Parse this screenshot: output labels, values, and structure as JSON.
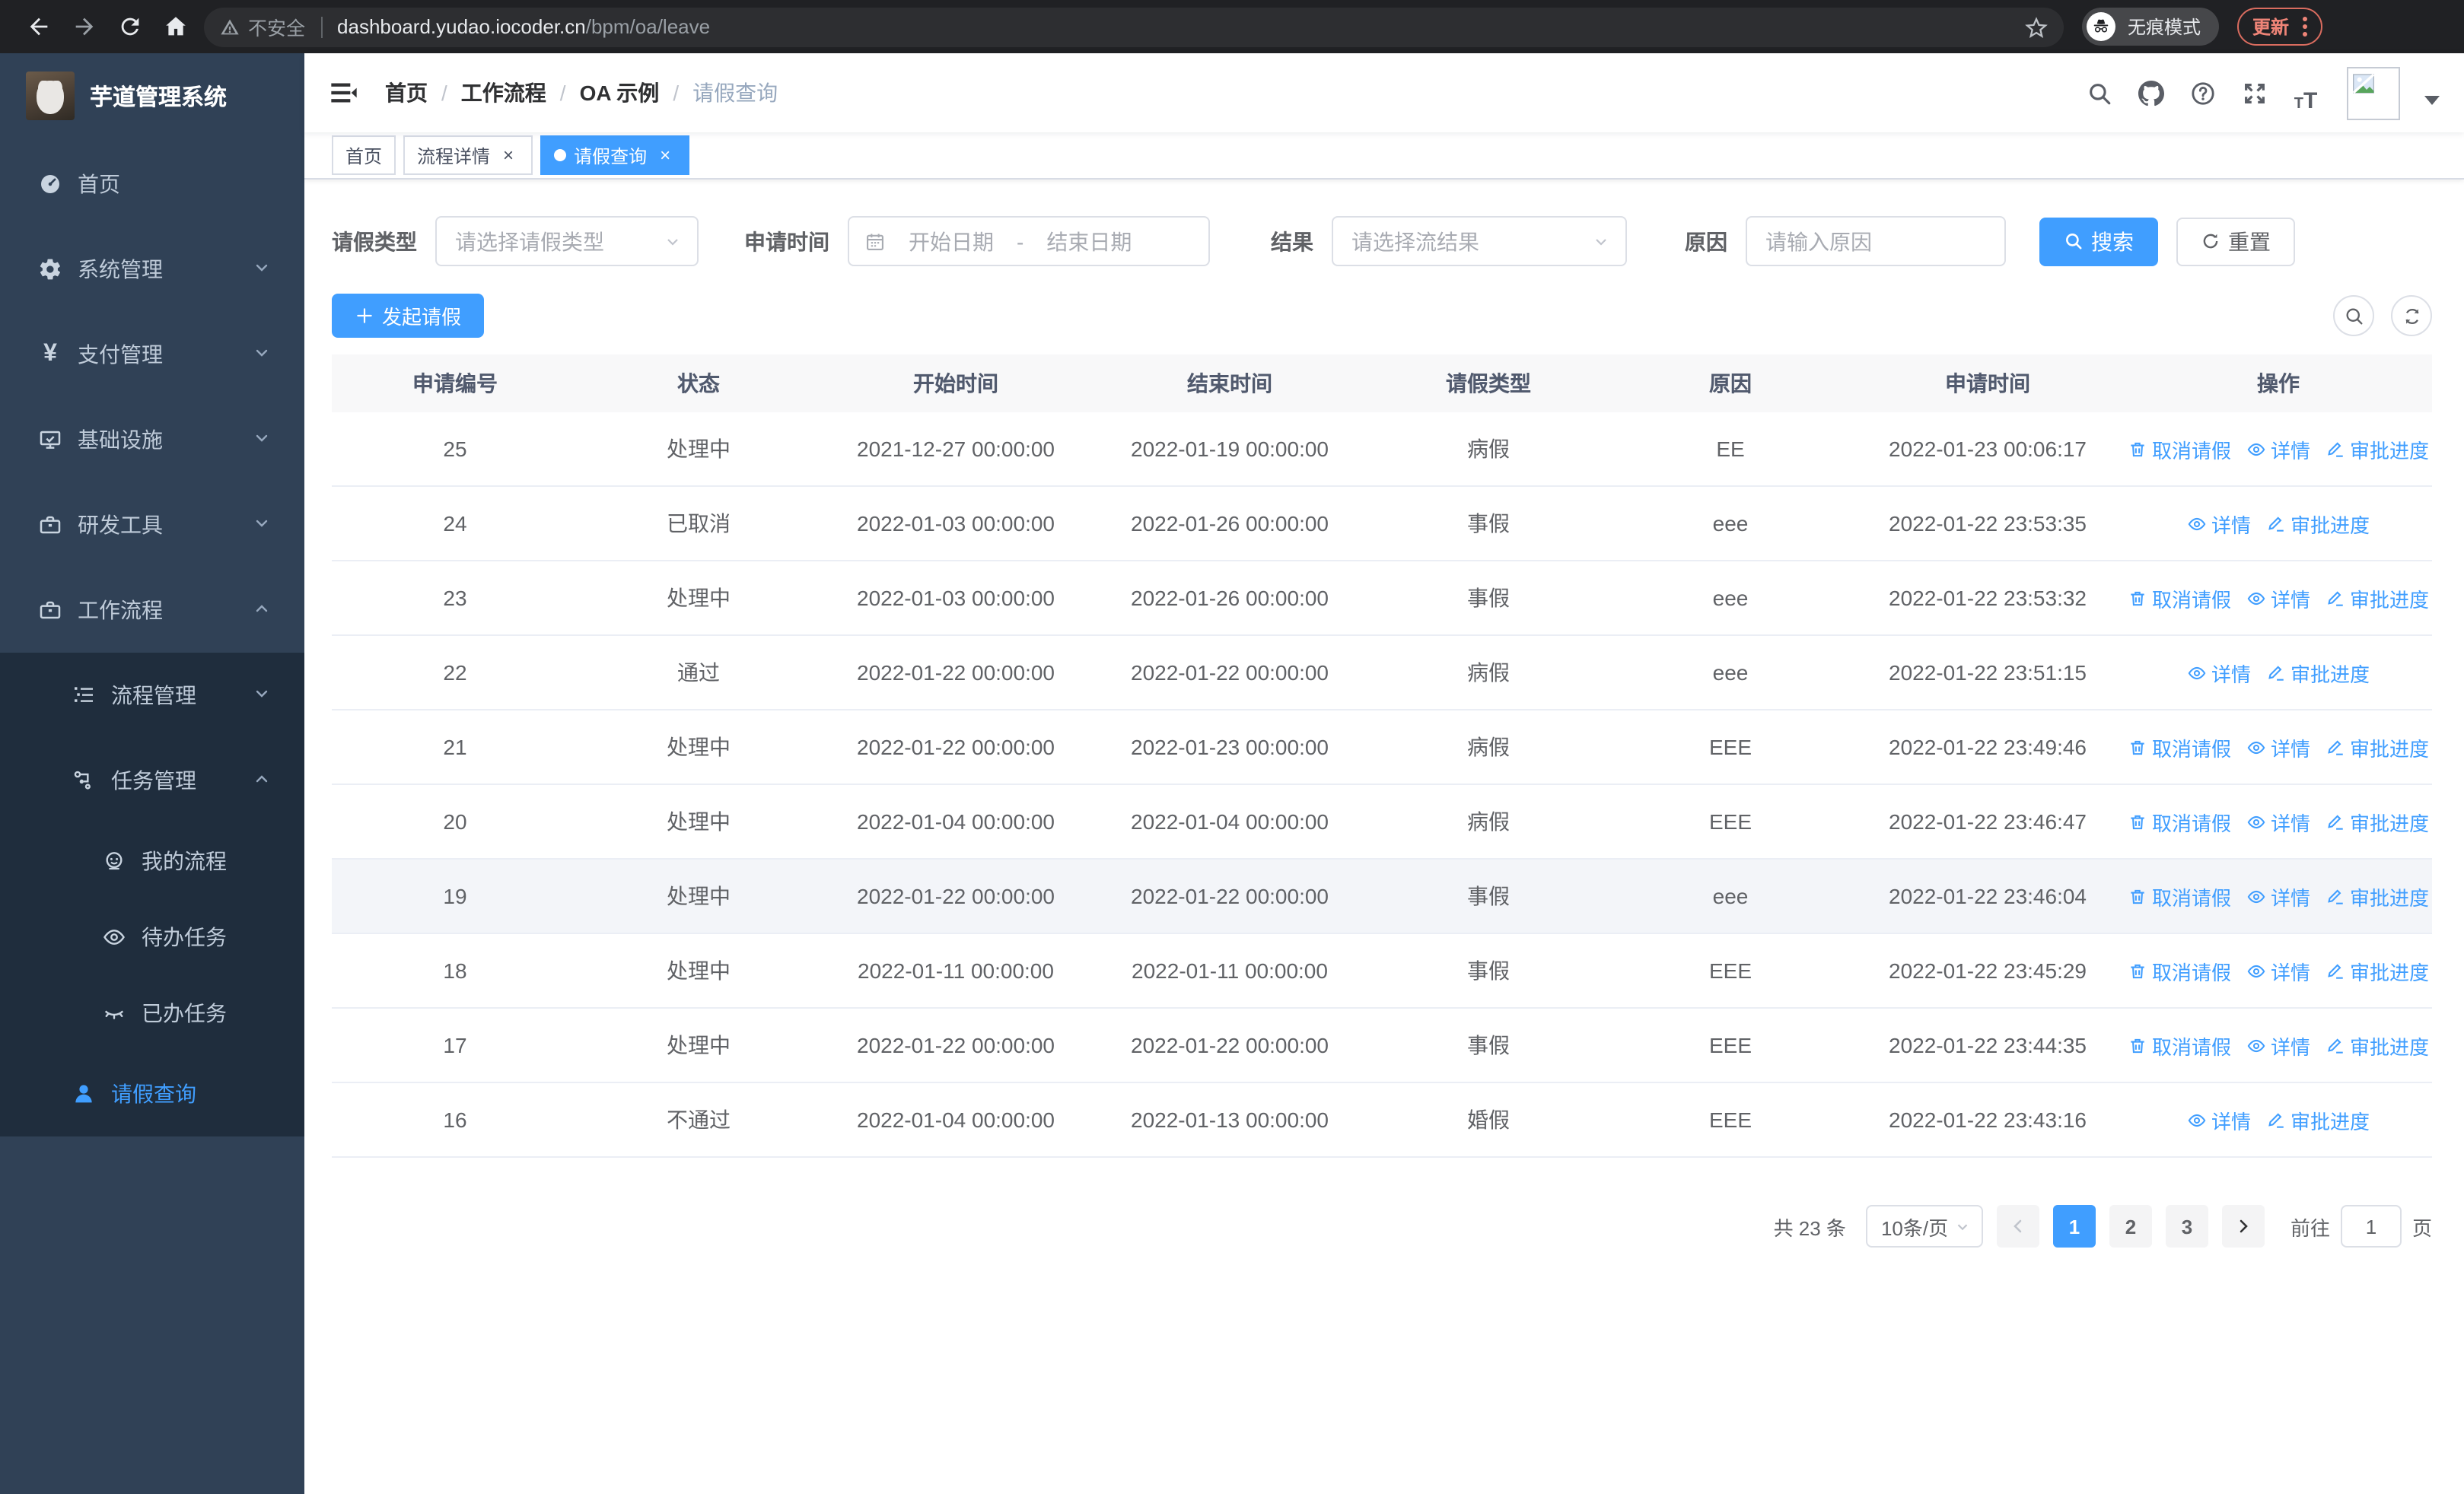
{
  "browser": {
    "security_label": "不安全",
    "url_host": "dashboard.yudao.iocoder.cn",
    "url_path": "/bpm/oa/leave",
    "incognito_label": "无痕模式",
    "update_label": "更新"
  },
  "sidebar": {
    "app_title": "芋道管理系统",
    "items": [
      {
        "label": "首页"
      },
      {
        "label": "系统管理"
      },
      {
        "label": "支付管理"
      },
      {
        "label": "基础设施"
      },
      {
        "label": "研发工具"
      },
      {
        "label": "工作流程"
      },
      {
        "label": "流程管理"
      },
      {
        "label": "任务管理"
      },
      {
        "label": "我的流程"
      },
      {
        "label": "待办任务"
      },
      {
        "label": "已办任务"
      },
      {
        "label": "请假查询"
      }
    ],
    "yen_glyph": "¥"
  },
  "header": {
    "breadcrumbs": [
      "首页",
      "工作流程",
      "OA 示例",
      "请假查询"
    ],
    "breadcrumb_separator": "/"
  },
  "tabs": {
    "close_glyph": "×",
    "items": [
      {
        "label": "首页"
      },
      {
        "label": "流程详情"
      },
      {
        "label": "请假查询"
      }
    ]
  },
  "filters": {
    "leave_type_label": "请假类型",
    "leave_type_placeholder": "请选择请假类型",
    "apply_time_label": "申请时间",
    "start_date_placeholder": "开始日期",
    "range_separator": "-",
    "end_date_placeholder": "结束日期",
    "result_label": "结果",
    "result_placeholder": "请选择流结果",
    "reason_label": "原因",
    "reason_placeholder": "请输入原因",
    "search_label": "搜索",
    "reset_label": "重置"
  },
  "toolbar": {
    "create_label": "发起请假"
  },
  "table": {
    "columns": [
      "申请编号",
      "状态",
      "开始时间",
      "结束时间",
      "请假类型",
      "原因",
      "申请时间",
      "操作"
    ],
    "action_labels": {
      "cancel": "取消请假",
      "detail": "详情",
      "progress": "审批进度"
    },
    "rows": [
      {
        "id": "25",
        "status": "处理中",
        "start": "2021-12-27 00:00:00",
        "end": "2022-01-19 00:00:00",
        "type": "病假",
        "reason": "EE",
        "apply_time": "2022-01-23 00:06:17",
        "actions": [
          "cancel",
          "detail",
          "progress"
        ],
        "highlight": false
      },
      {
        "id": "24",
        "status": "已取消",
        "start": "2022-01-03 00:00:00",
        "end": "2022-01-26 00:00:00",
        "type": "事假",
        "reason": "eee",
        "apply_time": "2022-01-22 23:53:35",
        "actions": [
          "detail",
          "progress"
        ],
        "highlight": false
      },
      {
        "id": "23",
        "status": "处理中",
        "start": "2022-01-03 00:00:00",
        "end": "2022-01-26 00:00:00",
        "type": "事假",
        "reason": "eee",
        "apply_time": "2022-01-22 23:53:32",
        "actions": [
          "cancel",
          "detail",
          "progress"
        ],
        "highlight": false
      },
      {
        "id": "22",
        "status": "通过",
        "start": "2022-01-22 00:00:00",
        "end": "2022-01-22 00:00:00",
        "type": "病假",
        "reason": "eee",
        "apply_time": "2022-01-22 23:51:15",
        "actions": [
          "detail",
          "progress"
        ],
        "highlight": false
      },
      {
        "id": "21",
        "status": "处理中",
        "start": "2022-01-22 00:00:00",
        "end": "2022-01-23 00:00:00",
        "type": "病假",
        "reason": "EEE",
        "apply_time": "2022-01-22 23:49:46",
        "actions": [
          "cancel",
          "detail",
          "progress"
        ],
        "highlight": false
      },
      {
        "id": "20",
        "status": "处理中",
        "start": "2022-01-04 00:00:00",
        "end": "2022-01-04 00:00:00",
        "type": "病假",
        "reason": "EEE",
        "apply_time": "2022-01-22 23:46:47",
        "actions": [
          "cancel",
          "detail",
          "progress"
        ],
        "highlight": false
      },
      {
        "id": "19",
        "status": "处理中",
        "start": "2022-01-22 00:00:00",
        "end": "2022-01-22 00:00:00",
        "type": "事假",
        "reason": "eee",
        "apply_time": "2022-01-22 23:46:04",
        "actions": [
          "cancel",
          "detail",
          "progress"
        ],
        "highlight": true
      },
      {
        "id": "18",
        "status": "处理中",
        "start": "2022-01-11 00:00:00",
        "end": "2022-01-11 00:00:00",
        "type": "事假",
        "reason": "EEE",
        "apply_time": "2022-01-22 23:45:29",
        "actions": [
          "cancel",
          "detail",
          "progress"
        ],
        "highlight": false
      },
      {
        "id": "17",
        "status": "处理中",
        "start": "2022-01-22 00:00:00",
        "end": "2022-01-22 00:00:00",
        "type": "事假",
        "reason": "EEE",
        "apply_time": "2022-01-22 23:44:35",
        "actions": [
          "cancel",
          "detail",
          "progress"
        ],
        "highlight": false
      },
      {
        "id": "16",
        "status": "不通过",
        "start": "2022-01-04 00:00:00",
        "end": "2022-01-13 00:00:00",
        "type": "婚假",
        "reason": "EEE",
        "apply_time": "2022-01-22 23:43:16",
        "actions": [
          "detail",
          "progress"
        ],
        "highlight": false
      }
    ]
  },
  "pagination": {
    "total_label": "共 23 条",
    "page_size_label": "10条/页",
    "pages": [
      "1",
      "2",
      "3"
    ],
    "active_page": "1",
    "goto_label": "前往",
    "goto_value": "1",
    "goto_suffix": "页"
  },
  "colors": {
    "primary": "#409eff",
    "sidebar_bg": "#304156",
    "submenu_bg": "#1f2d3d",
    "sidebar_text": "#bfcbd9",
    "table_header_bg": "#f8f8f9",
    "row_border": "#ebeef5",
    "chrome_bg": "#202124",
    "update_accent": "#ee8477"
  }
}
